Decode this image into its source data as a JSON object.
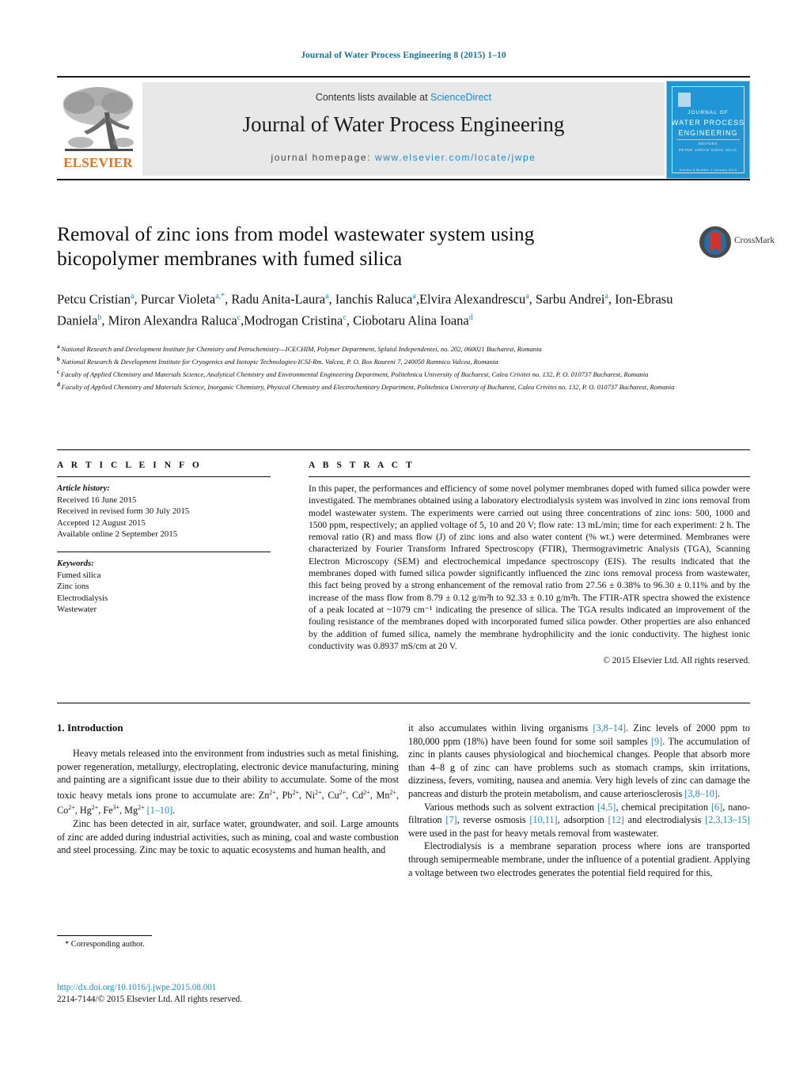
{
  "running_head": "Journal of Water Process Engineering 8 (2015) 1–10",
  "masthead": {
    "publisher_name": "ELSEVIER",
    "contents_prefix": "Contents lists available at ",
    "sciencedirect": "ScienceDirect",
    "journal_name": "Journal of Water Process Engineering",
    "homepage_prefix": "journal homepage: ",
    "homepage_url": "www.elsevier.com/locate/jwpe",
    "cover": {
      "line1": "JOURNAL OF",
      "line2": "WATER PROCESS",
      "line3": "ENGINEERING",
      "editors_label": "EDITORS",
      "editors": "PETER JARVIS   NIDAL HILAL",
      "footer": "Volume 8   Number 1   January 2015"
    }
  },
  "article": {
    "title": "Removal of zinc ions from model wastewater system using bicopolymer membranes with fumed silica",
    "crossmark_label": "CrossMark",
    "authors": [
      {
        "name": "Petcu Cristian",
        "marks": "a",
        "sep": ", "
      },
      {
        "name": "Purcar Violeta",
        "marks": "a,*",
        "sep": ", "
      },
      {
        "name": "Radu Anita-Laura",
        "marks": "a",
        "sep": ", "
      },
      {
        "name": "Ianchis Raluca",
        "marks": "a",
        "sep": ","
      },
      {
        "name": "Elvira Alexandrescu",
        "marks": "a",
        "sep": ", "
      },
      {
        "name": "Sarbu Andrei",
        "marks": "a",
        "sep": ", "
      },
      {
        "name": "Ion-Ebrasu Daniela",
        "marks": "b",
        "sep": ", "
      },
      {
        "name": "Miron Alexandra Raluca",
        "marks": "c",
        "sep": ","
      },
      {
        "name": "Modrogan Cristina",
        "marks": "c",
        "sep": ", "
      },
      {
        "name": "Ciobotaru Alina Ioana",
        "marks": "d",
        "sep": ""
      }
    ],
    "affiliations": [
      {
        "mark": "a",
        "text": "National Research and Development Institute for Chemistry and Petrochemistry—ICECHIM, Polymer Department, Splaiul Independentei, no. 202, 060021 Bucharest, Romania"
      },
      {
        "mark": "b",
        "text": "National Research & Development Institute for Cryogenics and Isotopic Technologies-ICSI-Rm. Valcea, P. O. Box Raureni 7, 240050 Ramnicu Valcea, Romania"
      },
      {
        "mark": "c",
        "text": "Faculty of Applied Chemistry and Materials Science, Analytical Chemistry and Environmental Engineering Department, Politehnica University of Bucharest, Calea Crivitei no. 132, P. O. 010737 Bucharest, Romania"
      },
      {
        "mark": "d",
        "text": "Faculty of Applied Chemistry and Materials Science, Inorganic Chemistry, Physical Chemistry and Electrochemistry Department, Politehnica University of Bucharest, Calea Crivitei no. 132, P. O. 010737 Bucharest, Romania"
      }
    ]
  },
  "article_info": {
    "heading": "A R T I C L E    I N F O",
    "history_label": "Article history:",
    "history": [
      "Received 16 June 2015",
      "Received in revised form 30 July 2015",
      "Accepted 12 August 2015",
      "Available online 2 September 2015"
    ],
    "keywords_label": "Keywords:",
    "keywords": [
      "Fumed silica",
      "Zinc ions",
      "Electrodialysis",
      "Wastewater"
    ]
  },
  "abstract": {
    "heading": "A B S T R A C T",
    "text": "In this paper, the performances and efficiency of some novel polymer membranes doped with fumed silica powder were investigated. The membranes obtained using a laboratory electrodialysis system was involved in zinc ions removal from model wastewater system. The experiments were carried out using three concentrations of zinc ions: 500, 1000 and 1500 ppm, respectively; an applied voltage of 5, 10 and 20 V; flow rate: 13 mL/min; time for each experiment: 2 h. The removal ratio (R) and mass flow (J) of zinc ions and also water content (% wt.) were determined. Membranes were characterized by Fourier Transform Infrared Spectroscopy (FTIR), Thermogravimetric Analysis (TGA), Scanning Electron Microscopy (SEM) and electrochemical impedance spectroscopy (EIS). The results indicated that the membranes doped with fumed silica powder significantly influenced the zinc ions removal process from wastewater, this fact being proved by a strong enhancement of the removal ratio from 27.56 ± 0.38% to 96.30 ± 0.11% and by the increase of the mass flow from 8.79 ± 0.12 g/m²h to 92.33 ± 0.10 g/m²h. The FTIR-ATR spectra showed the existence of a peak located at ~1079 cm⁻¹ indicating the presence of silica. The TGA results indicated an improvement of the fouling resistance of the membranes doped with incorporated fumed silica powder. Other properties are also enhanced by the addition of fumed silica, namely the membrane hydrophilicity and the ionic conductivity. The highest ionic conductivity was 0.8937 mS/cm at 20 V.",
    "copyright": "© 2015 Elsevier Ltd. All rights reserved."
  },
  "body": {
    "section_heading": "1.  Introduction",
    "left_paragraphs": [
      "Heavy metals released into the environment from industries such as metal finishing, power regeneration, metallurgy, electroplating, electronic device manufacturing, mining and painting are a significant issue due to their ability to accumulate. Some of the most toxic heavy metals ions prone to accumulate are: Zn2+, Pb2+, Ni2+, Cu2+, Cd2+, Mn 2+, Co2+, Hg2+, Fe 3+, Mg2+ [1–10].",
      "Zinc has been detected in air, surface water, groundwater, and soil. Large amounts of zinc are added during industrial activities, such as mining, coal and waste combustion and steel processing. Zinc may be toxic to aquatic ecosystems and human health, and"
    ],
    "right_paragraphs": [
      "it also accumulates within living organisms [3,8–14]. Zinc levels of 2000 ppm to 180,000 ppm (18%) have been found for some soil samples [9]. The accumulation of zinc in plants causes physiological and biochemical changes. People that absorb more than 4–8 g of zinc can have problems such as stomach cramps, skin irritations, dizziness, fevers, vomiting, nausea and anemia. Very high levels of zinc can damage the pancreas and disturb the protein metabolism, and cause arteriosclerosis [3,8–10].",
      "Various methods such as solvent extraction [4,5], chemical precipitation [6], nano-filtration [7], reverse osmosis [10,11], adsorption [12] and electrodialysis [2,3,13–15] were used in the past for heavy metals removal from wastewater.",
      "Electrodialysis is a membrane separation process where ions are transported through semipermeable membrane, under the influence of a potential gradient. Applying a voltage between two electrodes generates the potential field required for this,"
    ]
  },
  "footer": {
    "corresponding_note": "* Corresponding author.",
    "doi": "http://dx.doi.org/10.1016/j.jwpe.2015.08.001",
    "issn_line": "2214-7144/© 2015 Elsevier Ltd. All rights reserved."
  },
  "colors": {
    "link": "#1a8ad4",
    "running_head": "#1a6ea8",
    "elsevier_orange": "#E9711C",
    "cover_blue": "#2196d6",
    "band_gray": "#e8e8e8"
  }
}
